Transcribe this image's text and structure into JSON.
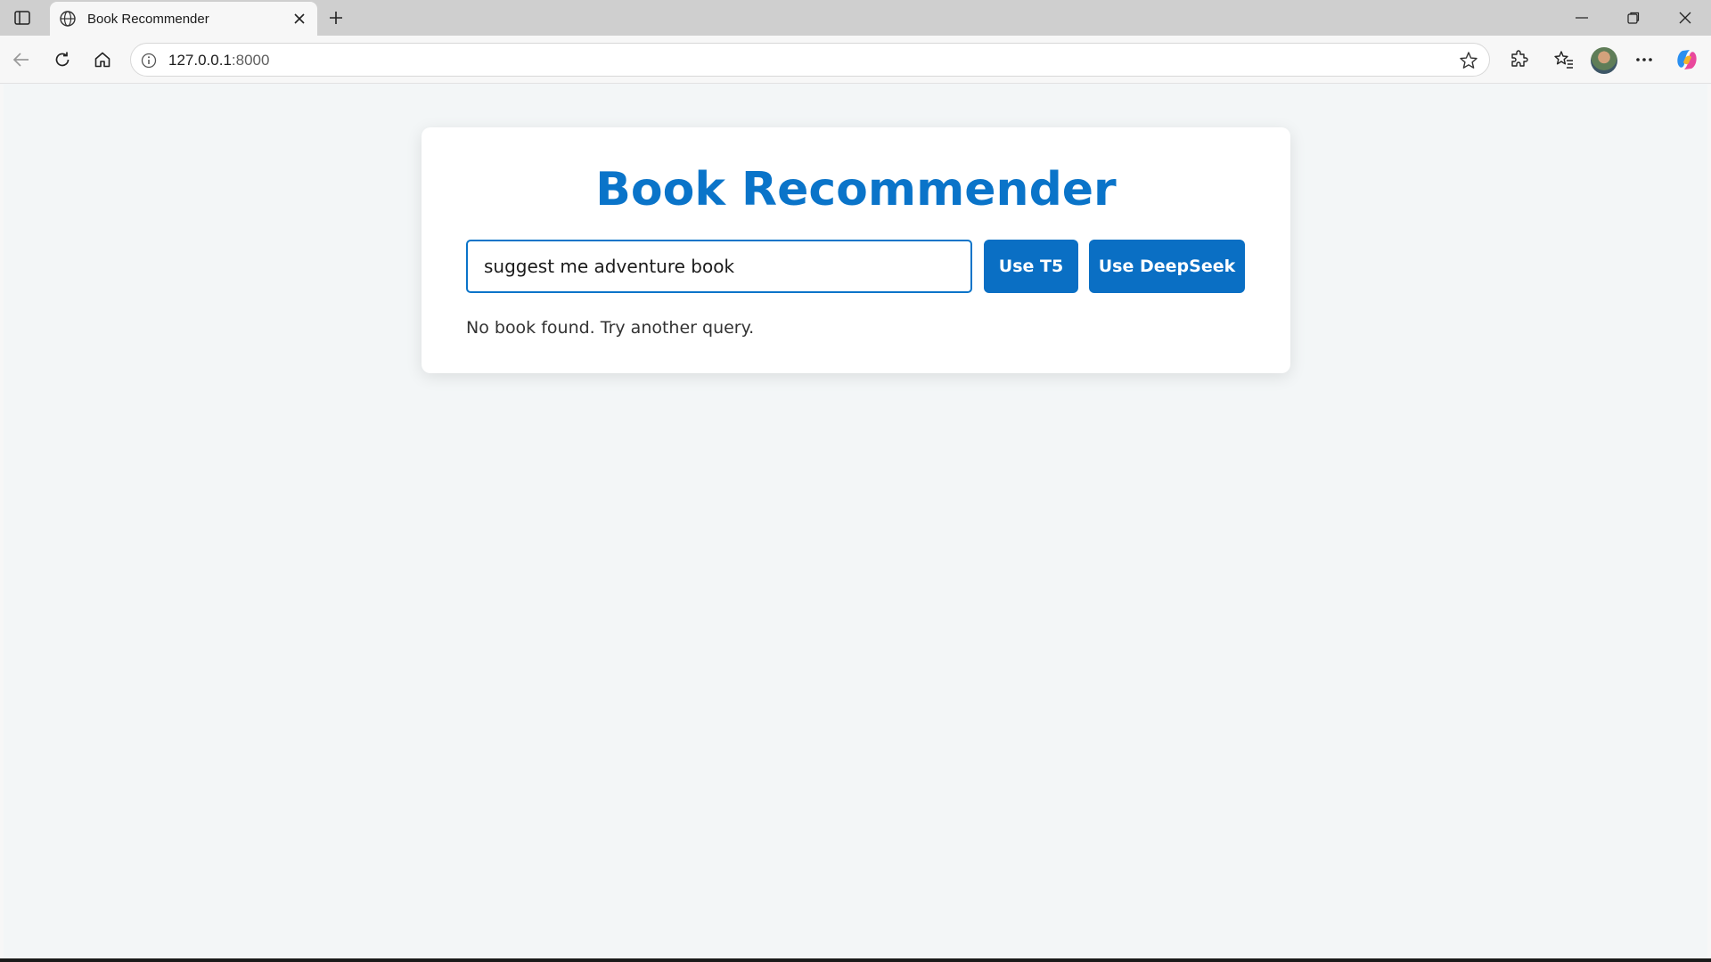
{
  "browser": {
    "tab_title": "Book Recommender",
    "url_host": "127.0.0.1",
    "url_port": ":8000",
    "icons": [
      "sidebar-toggle-icon",
      "globe-icon",
      "close-icon",
      "plus-icon",
      "minimize-icon",
      "restore-icon",
      "close-window-icon",
      "back-icon",
      "refresh-icon",
      "home-icon",
      "info-icon",
      "star-icon",
      "extensions-icon",
      "favorites-icon",
      "avatar",
      "more-icon",
      "copilot-icon"
    ]
  },
  "page": {
    "heading": "Book Recommender",
    "query_value": "suggest me adventure book",
    "button_t5": "Use T5",
    "button_deepseek": "Use DeepSeek",
    "result_text": "No book found. Try another query.",
    "accent_color": "#0a74c9",
    "button_color": "#0a6fc4",
    "background_color": "#f3f6f7"
  }
}
